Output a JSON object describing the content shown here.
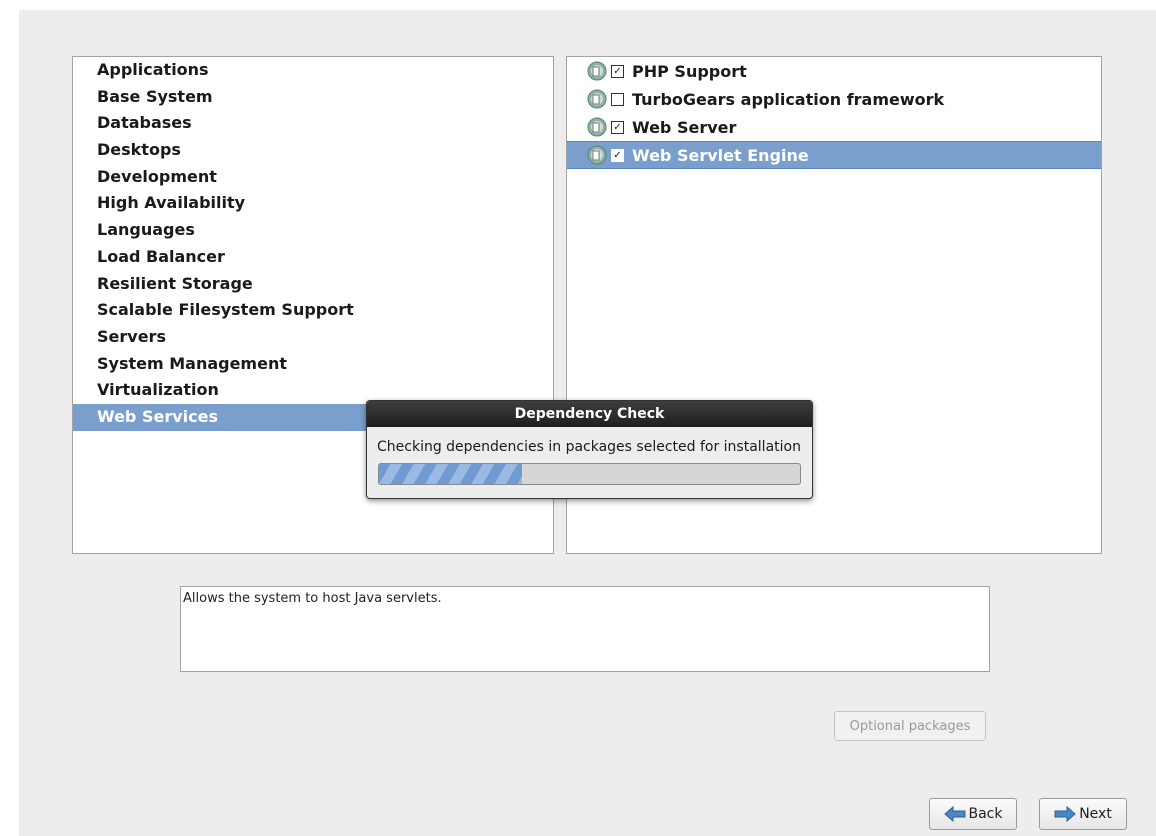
{
  "groups": {
    "items": [
      {
        "label": "Applications"
      },
      {
        "label": "Base System"
      },
      {
        "label": "Databases"
      },
      {
        "label": "Desktops"
      },
      {
        "label": "Development"
      },
      {
        "label": "High Availability"
      },
      {
        "label": "Languages"
      },
      {
        "label": "Load Balancer"
      },
      {
        "label": "Resilient Storage"
      },
      {
        "label": "Scalable Filesystem Support"
      },
      {
        "label": "Servers"
      },
      {
        "label": "System Management"
      },
      {
        "label": "Virtualization"
      },
      {
        "label": "Web Services",
        "selected": true
      }
    ]
  },
  "packages": {
    "items": [
      {
        "label": "PHP Support",
        "checked": true,
        "icon": "package-icon"
      },
      {
        "label": "TurboGears application framework",
        "checked": false,
        "icon": "package-icon"
      },
      {
        "label": "Web Server",
        "checked": true,
        "icon": "package-icon"
      },
      {
        "label": "Web Servlet Engine",
        "checked": true,
        "selected": true,
        "icon": "package-icon"
      }
    ]
  },
  "description": {
    "text": "Allows the system to host Java servlets."
  },
  "buttons": {
    "optional_packages": "Optional packages",
    "back": "Back",
    "next": "Next"
  },
  "dialog": {
    "title": "Dependency Check",
    "message": "Checking dependencies in packages selected for installation",
    "progress": 0.34
  },
  "colors": {
    "selection": "#7a9fcd",
    "panel_bg": "#ededed",
    "progress_fill": "#6f9ad3"
  }
}
